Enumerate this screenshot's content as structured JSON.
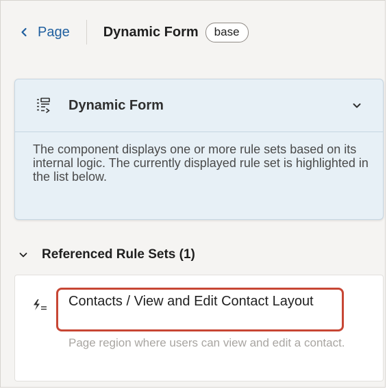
{
  "header": {
    "back_label": "Page",
    "title": "Dynamic Form",
    "badge": "base"
  },
  "info_card": {
    "title": "Dynamic Form",
    "description": "The component displays one or more rule sets based on its internal logic. The currently displayed rule set is highlighted in the list below."
  },
  "referenced_section": {
    "title": "Referenced Rule Sets (1)"
  },
  "rule_sets": [
    {
      "name": "Contacts / View and Edit Contact Layout",
      "description": "Page region where users can view and edit a contact."
    }
  ],
  "colors": {
    "link_blue": "#1f5f9f",
    "highlight_red": "#c74634",
    "card_bg": "#e7f0f6",
    "panel_bg": "#f5f4f2"
  },
  "icons": {
    "back": "chevron-left-icon",
    "form": "dynamic-form-icon",
    "collapse": "chevron-down-icon",
    "section_toggle": "chevron-down-icon",
    "rule": "rule-set-icon"
  }
}
